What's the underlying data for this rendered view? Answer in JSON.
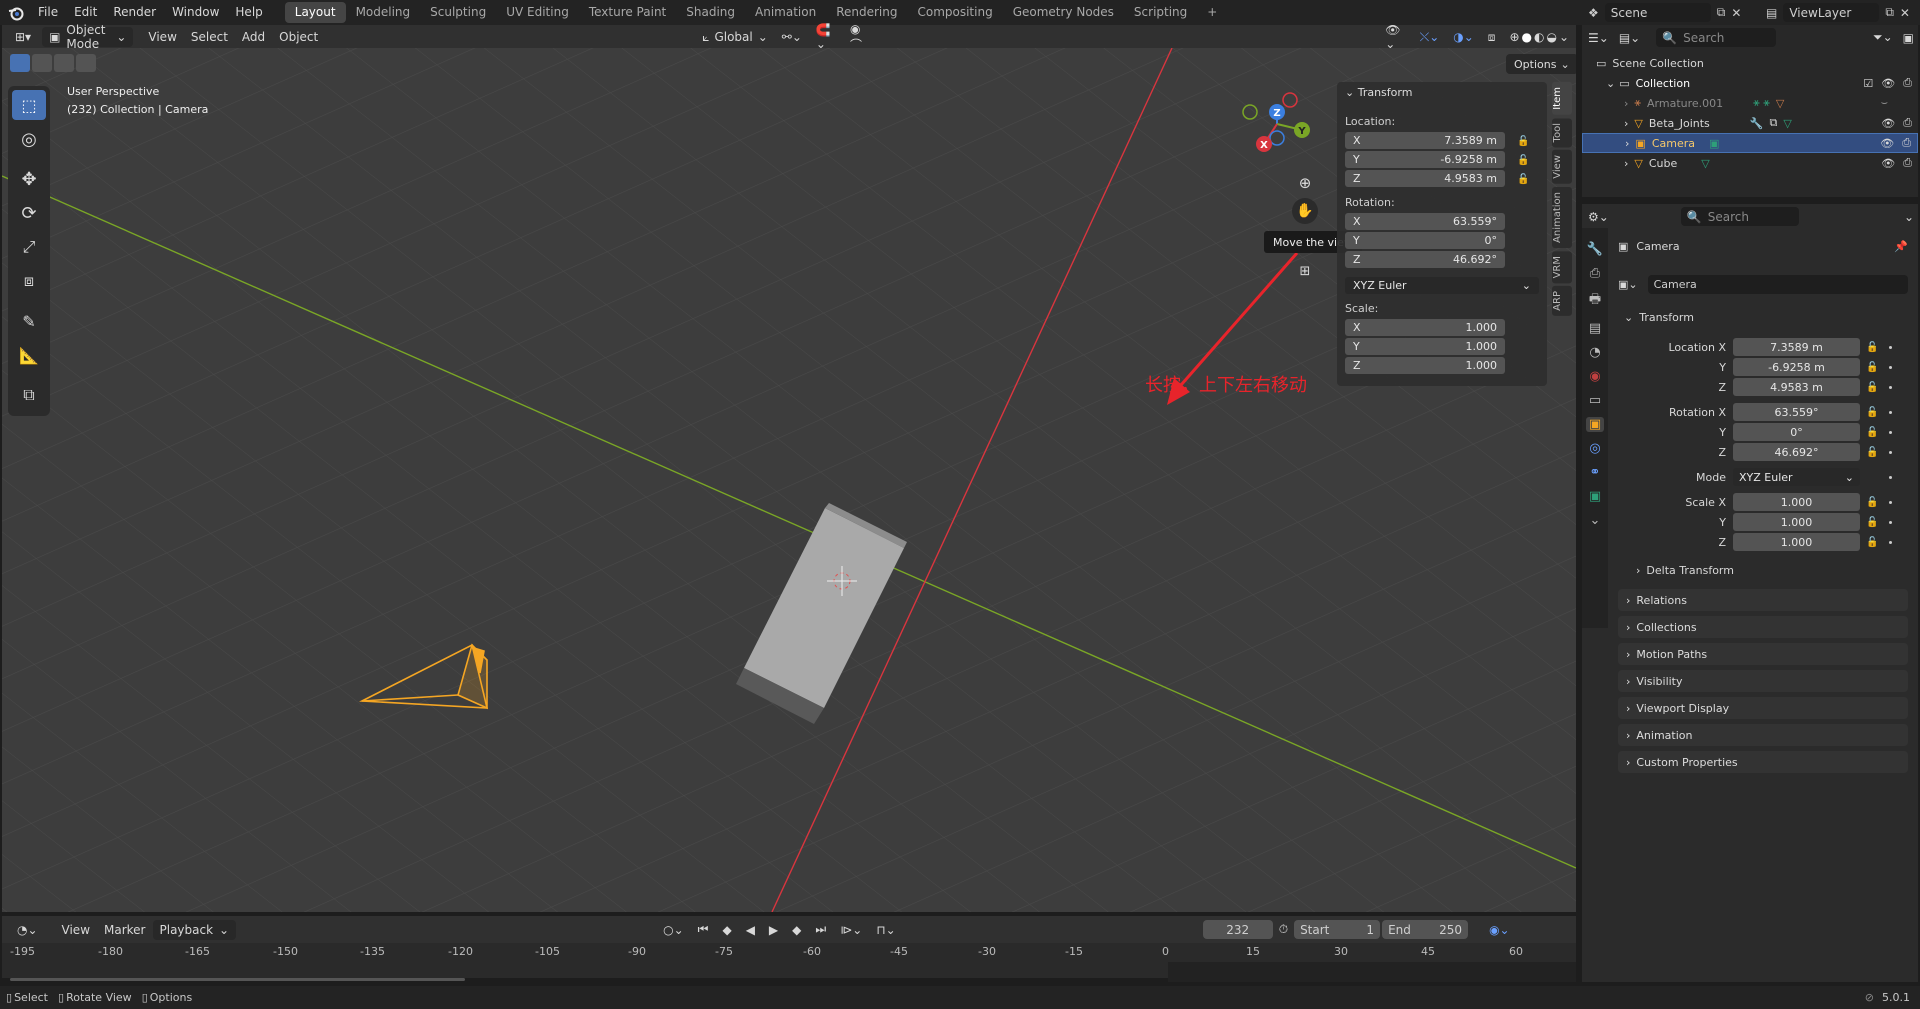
{
  "topbar": {
    "menus": [
      "File",
      "Edit",
      "Render",
      "Window",
      "Help"
    ],
    "workspaces": [
      "Layout",
      "Modeling",
      "Sculpting",
      "UV Editing",
      "Texture Paint",
      "Shading",
      "Animation",
      "Rendering",
      "Compositing",
      "Geometry Nodes",
      "Scripting"
    ],
    "active_workspace": "Layout",
    "add_tab": "+",
    "scene": "Scene",
    "view_layer": "ViewLayer"
  },
  "viewport_header": {
    "mode": "Object Mode",
    "menus": [
      "View",
      "Select",
      "Add",
      "Object"
    ],
    "orientation": "Global",
    "options": "Options"
  },
  "viewport": {
    "perspective": "User Perspective",
    "context": "(232) Collection | Camera",
    "tooltip": "Move the view",
    "annotation": "长按，上下左右移动",
    "annotation_color": "#e8242b",
    "gizmo": {
      "x": "X",
      "y": "Y",
      "z": "Z"
    }
  },
  "npanel": {
    "title": "Transform",
    "location_label": "Location:",
    "location": [
      [
        "X",
        "7.3589 m"
      ],
      [
        "Y",
        "-6.9258 m"
      ],
      [
        "Z",
        "4.9583 m"
      ]
    ],
    "rotation_label": "Rotation:",
    "rotation": [
      [
        "X",
        "63.559°"
      ],
      [
        "Y",
        "0°"
      ],
      [
        "Z",
        "46.692°"
      ]
    ],
    "rotation_mode": "XYZ Euler",
    "scale_label": "Scale:",
    "scale": [
      [
        "X",
        "1.000"
      ],
      [
        "Y",
        "1.000"
      ],
      [
        "Z",
        "1.000"
      ]
    ],
    "tabs": [
      "Item",
      "Tool",
      "View",
      "Animation",
      "VRM",
      "ARP"
    ]
  },
  "timeline": {
    "menus": [
      "View",
      "Marker",
      "Playback"
    ],
    "current_frame": "232",
    "start_label": "Start",
    "start": "1",
    "end_label": "End",
    "end": "250",
    "ruler": [
      "-195",
      "-180",
      "-165",
      "-150",
      "-135",
      "-120",
      "-105",
      "-90",
      "-75",
      "-60",
      "-45",
      "-30",
      "-15",
      "0",
      "15",
      "30",
      "45",
      "60"
    ]
  },
  "status": {
    "items": [
      "Select",
      "Rotate View",
      "Options"
    ],
    "version": "5.0.1"
  },
  "outliner": {
    "search_placeholder": "Search",
    "scene_collection": "Scene Collection",
    "collection": "Collection",
    "items": [
      "Armature.001",
      "Beta_Joints",
      "Camera",
      "Cube"
    ],
    "selected": "Camera"
  },
  "properties": {
    "search_placeholder": "Search",
    "object_name": "Camera",
    "datablock": "Camera",
    "transform_title": "Transform",
    "location_x_label": "Location X",
    "location": [
      "7.3589 m",
      "-6.9258 m",
      "4.9583 m"
    ],
    "rotation_x_label": "Rotation X",
    "rotation": [
      "63.559°",
      "0°",
      "46.692°"
    ],
    "mode_label": "Mode",
    "mode": "XYZ Euler",
    "scale_x_label": "Scale X",
    "scale": [
      "1.000",
      "1.000",
      "1.000"
    ],
    "y_label": "Y",
    "z_label": "Z",
    "delta": "Delta Transform",
    "sections": [
      "Relations",
      "Collections",
      "Motion Paths",
      "Visibility",
      "Viewport Display",
      "Animation",
      "Custom Properties"
    ]
  },
  "colors": {
    "accent": "#4772b3",
    "selected_row": "#334d80",
    "x_axis": "#d8353e",
    "y_axis": "#7aa626",
    "camera": "#f5a623"
  }
}
